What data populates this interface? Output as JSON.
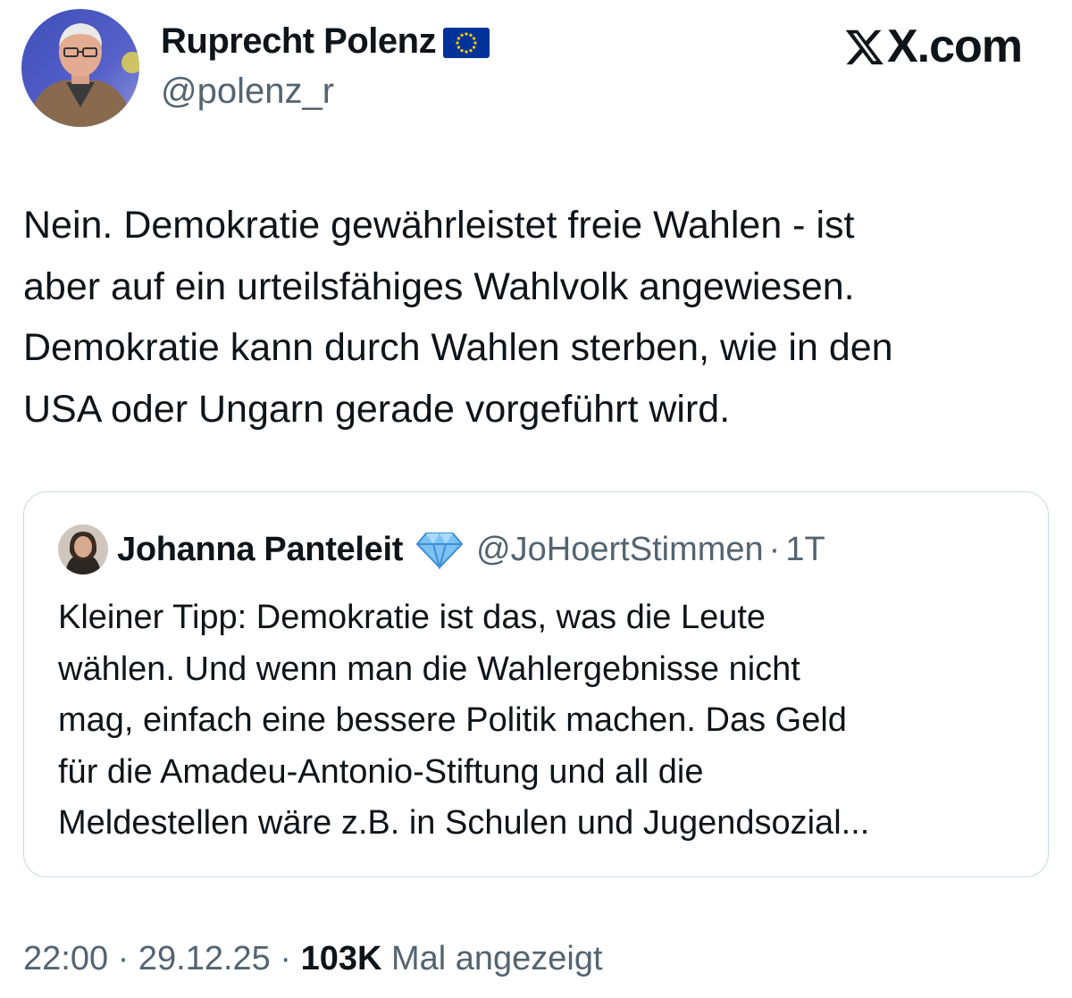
{
  "author": {
    "name": "Ruprecht Polenz",
    "handle": "@polenz_r",
    "flag_icon": "eu-flag-icon"
  },
  "brand": {
    "text": "X.com"
  },
  "tweet": {
    "lines": [
      "Nein. Demokratie gewährleistet freie Wahlen - ist",
      "aber auf ein urteilsfähiges Wahlvolk angewiesen.",
      "Demokratie kann durch Wahlen sterben, wie in den",
      "USA oder Ungarn gerade vorgeführt wird."
    ]
  },
  "quote": {
    "name": "Johanna Panteleit",
    "badge_icon": "diamond-icon",
    "handle": "@JoHoertStimmen",
    "separator": "·",
    "time": "1T",
    "lines": [
      "Kleiner Tipp: Demokratie ist das, was die Leute",
      "wählen. Und wenn man die Wahlergebnisse nicht",
      "mag, einfach eine bessere Politik machen. Das Geld",
      "für die Amadeu-Antonio-Stiftung und all die",
      "Meldestellen wäre z.B. in Schulen und Jugendsozial..."
    ]
  },
  "meta": {
    "time": "22:00",
    "sep1": " · ",
    "date": "29.12.25",
    "sep2": " · ",
    "views_count": "103K",
    "views_label": " Mal angezeigt"
  },
  "colors": {
    "text": "#0f1419",
    "muted": "#536471",
    "border": "#cfd9de",
    "eu_blue": "#003399",
    "eu_gold": "#ffcc00",
    "diamond": "#4fa3e6"
  }
}
